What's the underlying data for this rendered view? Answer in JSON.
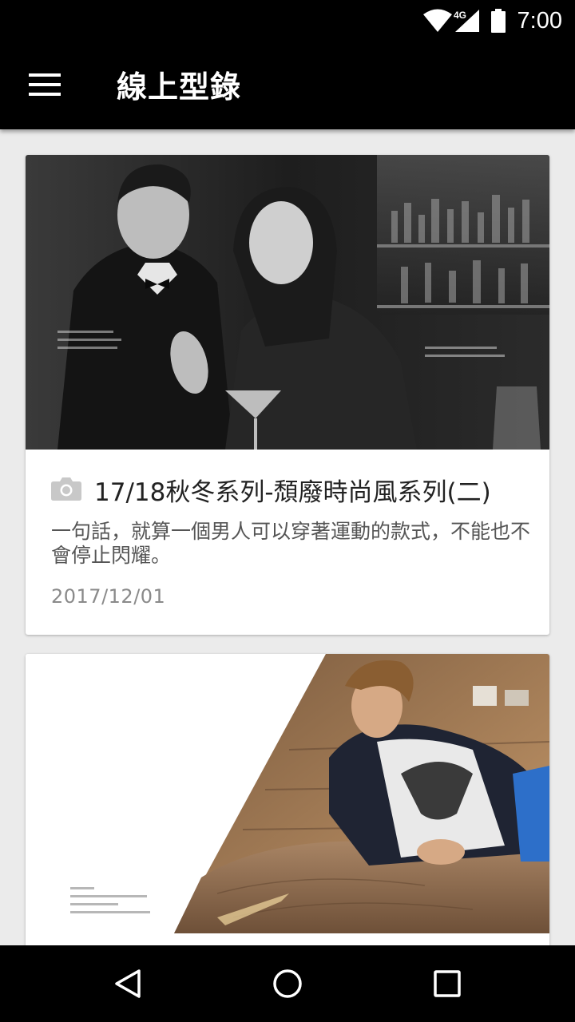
{
  "status_bar": {
    "time": "7:00",
    "network": "4G",
    "icons": [
      "wifi-icon",
      "cellular-signal-icon",
      "battery-icon"
    ]
  },
  "app_bar": {
    "title": "線上型錄",
    "menu_icon": "hamburger-menu-icon"
  },
  "catalog": [
    {
      "title": "17/18秋冬系列-頹廢時尚風系列(二)",
      "description": "一句話，就算一個男人可以穿著運動的款式，不能也不會停止閃耀。",
      "date": "2017/12/01",
      "icon": "camera-icon",
      "image": "bar-couple-photo"
    },
    {
      "image": "reclining-man-photo"
    }
  ],
  "nav_bar": {
    "icons": [
      "back-icon",
      "home-icon",
      "recent-apps-icon"
    ]
  },
  "colors": {
    "app_bar": "#000000",
    "background": "#ebebeb",
    "card": "#ffffff",
    "title_text": "#222222",
    "description_text": "#555555",
    "date_text": "#8a8a8a"
  }
}
